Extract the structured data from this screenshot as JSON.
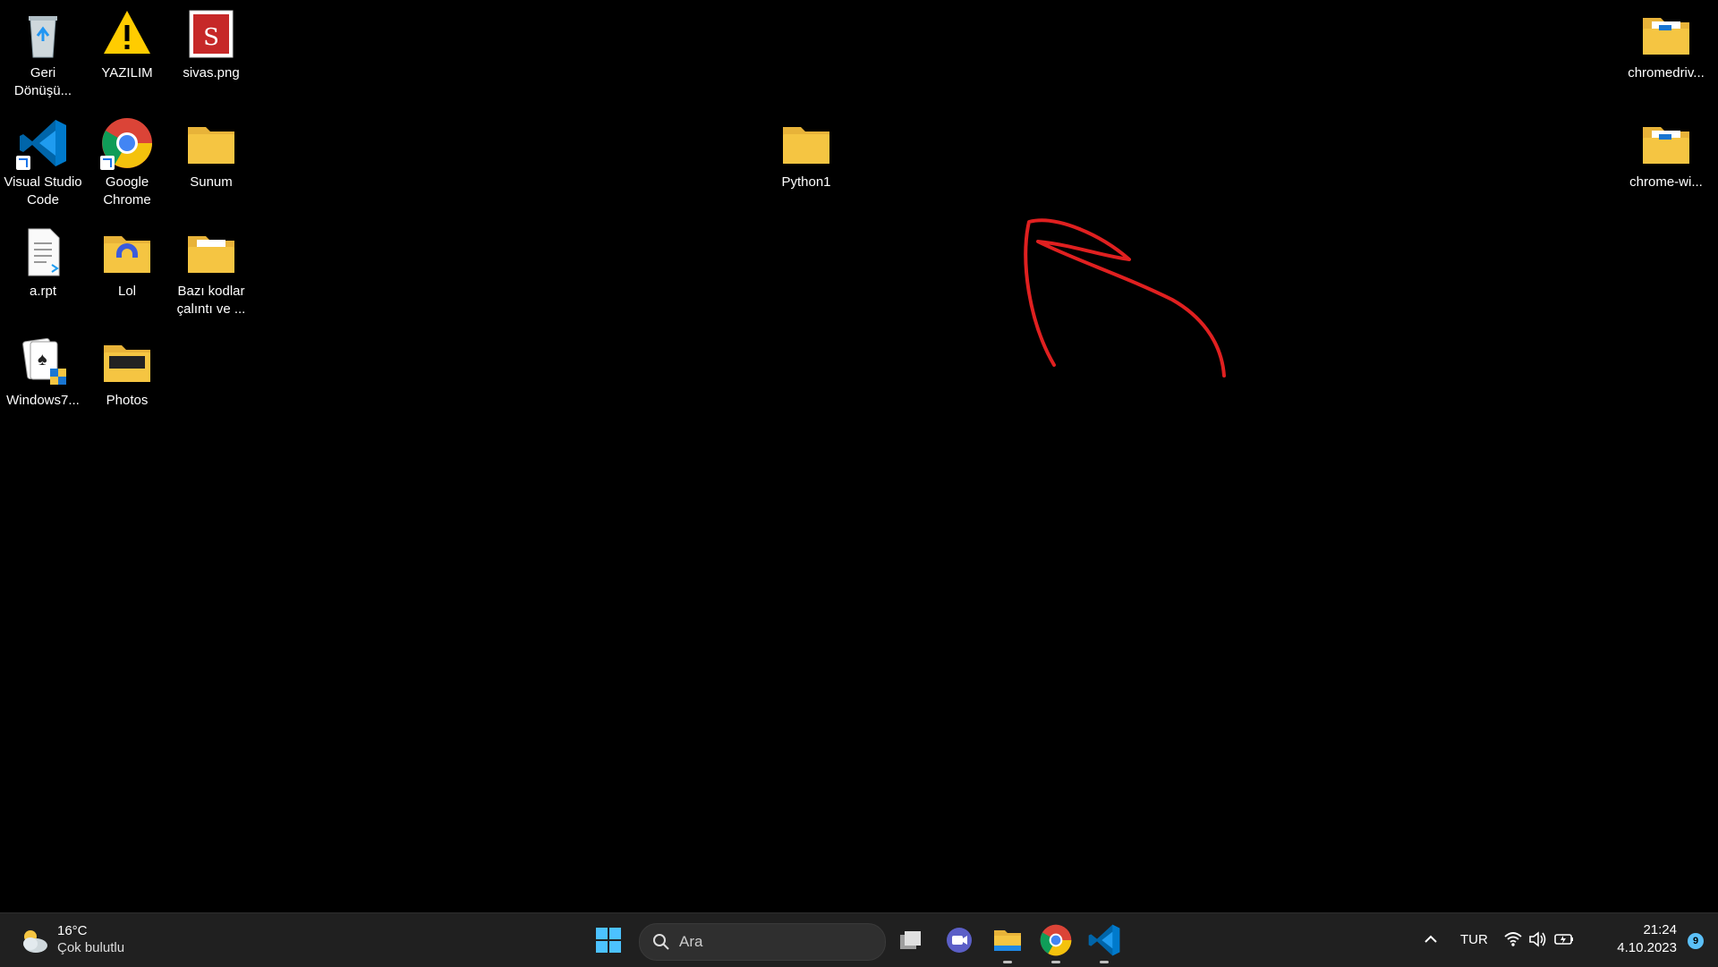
{
  "desktop_icons": [
    {
      "label": "Geri Dönüşü...",
      "icon": "recycle-bin-icon"
    },
    {
      "label": "YAZILIM",
      "icon": "warning-icon"
    },
    {
      "label": "sivas.png",
      "icon": "image-file-icon"
    },
    {
      "label": "Visual Studio Code",
      "icon": "vscode-icon"
    },
    {
      "label": "Google Chrome",
      "icon": "chrome-icon"
    },
    {
      "label": "Sunum",
      "icon": "folder-icon"
    },
    {
      "label": "a.rpt",
      "icon": "document-icon"
    },
    {
      "label": "Lol",
      "icon": "folder-icon"
    },
    {
      "label": "Bazı kodlar çalıntı ve ...",
      "icon": "folder-icon"
    },
    {
      "label": "Windows7...",
      "icon": "solitaire-icon"
    },
    {
      "label": "Photos",
      "icon": "folder-icon"
    },
    {
      "label": "Python1",
      "icon": "folder-icon"
    },
    {
      "label": "chromedriv...",
      "icon": "folder-icon"
    },
    {
      "label": "chrome-wi...",
      "icon": "folder-icon"
    }
  ],
  "annotation": {
    "color": "#e02020",
    "icon": "hand-drawn-arrow"
  },
  "taskbar": {
    "weather": {
      "temp": "16°C",
      "condition": "Çok bulutlu",
      "icon": "cloudy-icon"
    },
    "search": {
      "placeholder": "Ara"
    },
    "pinned": [
      "start-icon",
      "task-view-icon",
      "teams-icon",
      "file-explorer-icon",
      "chrome-icon",
      "vscode-icon"
    ],
    "tray": {
      "language": "TUR",
      "time": "21:24",
      "date": "4.10.2023",
      "notifications": "9"
    }
  },
  "colors": {
    "taskbar_bg": "#202020",
    "desktop_bg": "#000000",
    "folder": "#f5c542",
    "accent": "#5bc0f8"
  }
}
